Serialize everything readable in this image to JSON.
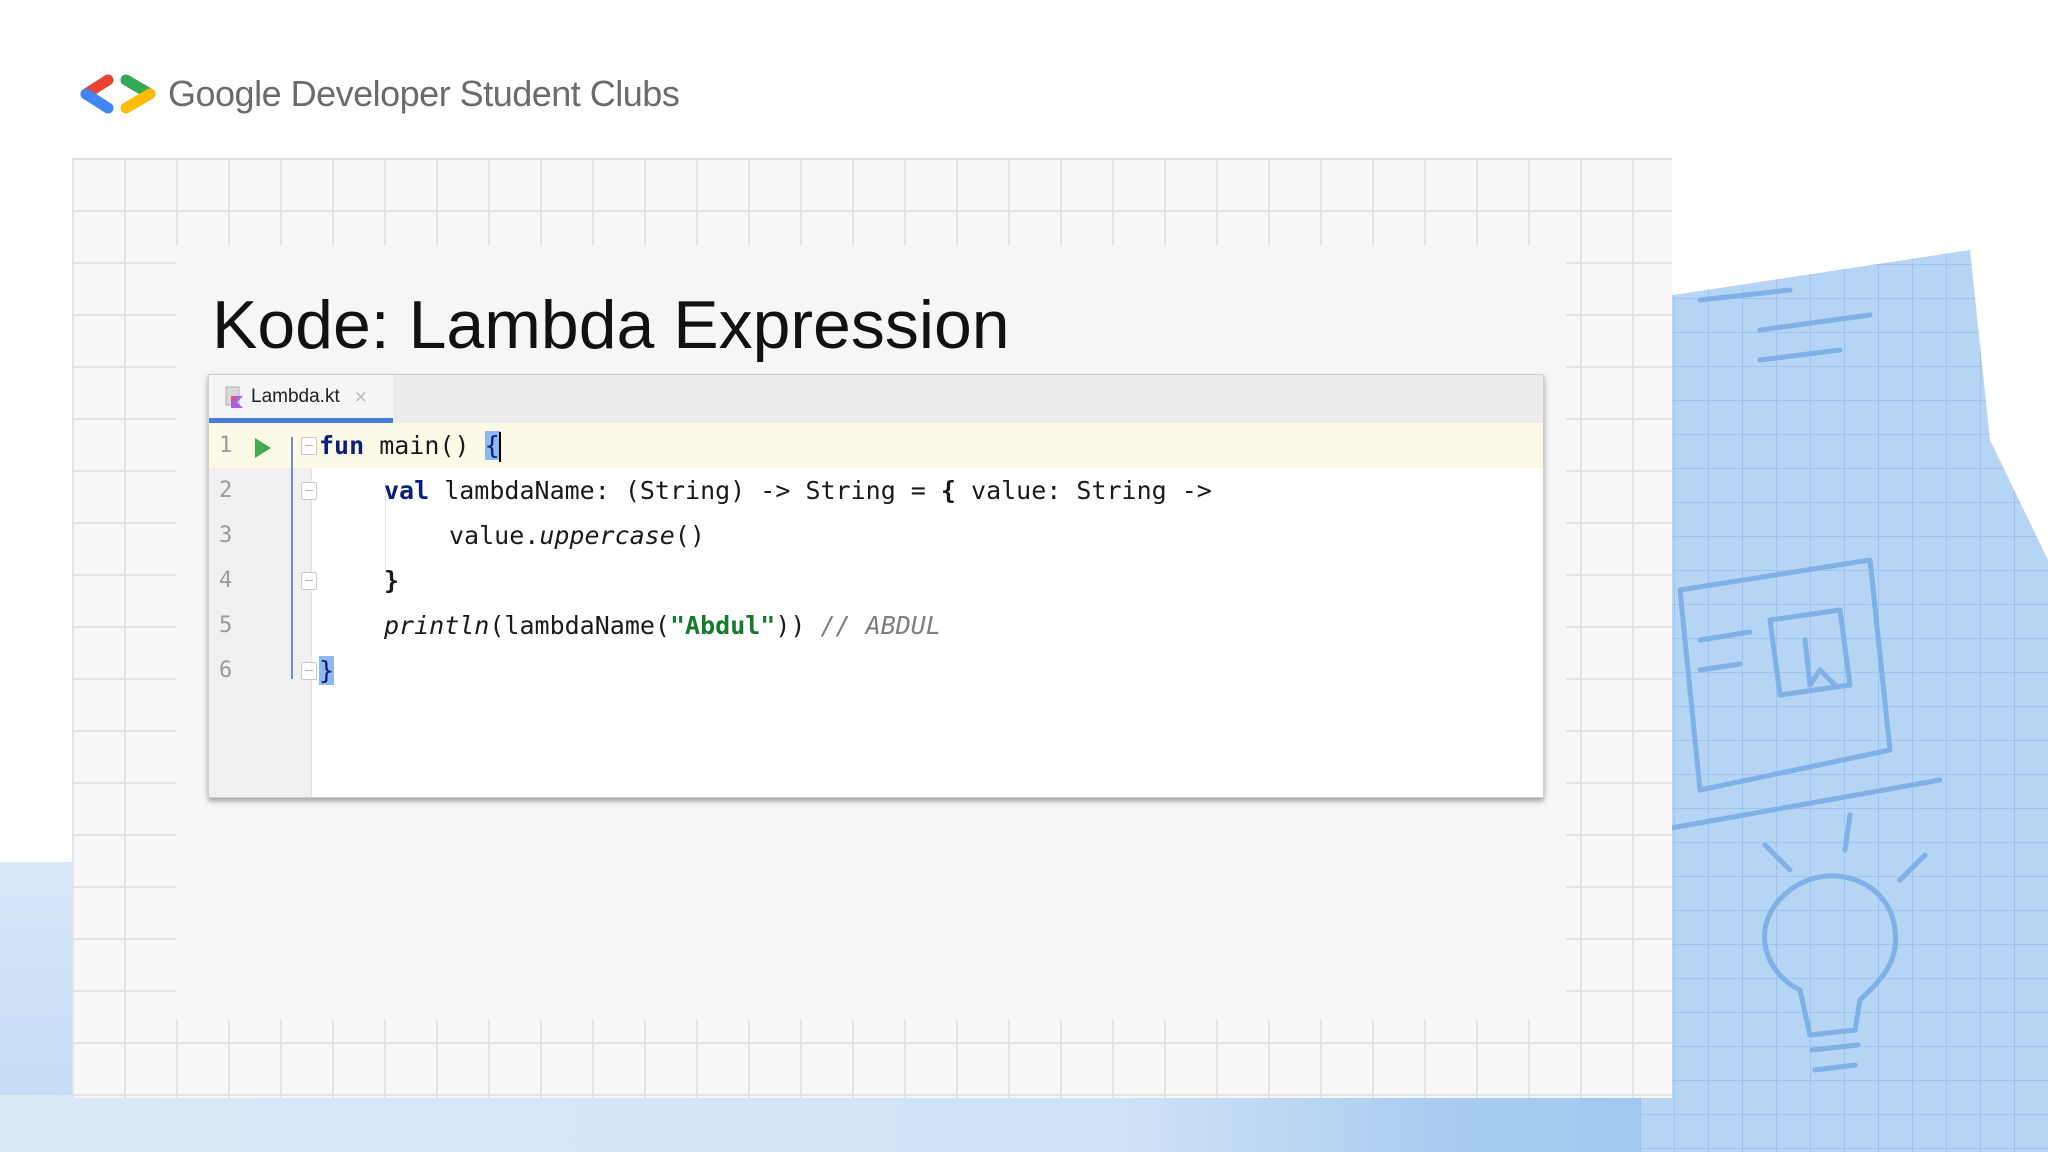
{
  "header": {
    "brand": "Google Developer Student Clubs",
    "logo_icon": "gdsc-brackets-icon",
    "logo_colors": {
      "red": "#ea4335",
      "blue": "#4285f4",
      "green": "#34a853",
      "yellow": "#fbbc04"
    }
  },
  "slide": {
    "title": "Kode: Lambda Expression"
  },
  "editor": {
    "tab": {
      "label": "Lambda.kt",
      "close_symbol": "×",
      "icon": "kotlin-file-icon"
    },
    "line_numbers": [
      "1",
      "2",
      "3",
      "4",
      "5",
      "6"
    ],
    "run_icon": "run-triangle-icon",
    "code": {
      "line1": {
        "kw": "fun",
        "rest": " main() ",
        "brace": "{"
      },
      "line2": {
        "kw": "val",
        "rest": " lambdaName: (String) -> String = ",
        "brace": "{",
        "tail": " value: String ->"
      },
      "line3": {
        "prefix": "value.",
        "fn": "uppercase",
        "suffix": "()"
      },
      "line4": {
        "brace": "}"
      },
      "line5": {
        "fn": "println",
        "mid": "(lambdaName(",
        "str": "\"Abdul\"",
        "close": "))",
        "comment": " // ABDUL"
      },
      "line6": {
        "brace": "}"
      }
    },
    "colors": {
      "keyword": "#0b1f7a",
      "string": "#137a2e",
      "comment": "#7e7e7e",
      "current_line": "#fcfae7",
      "brace_match": "#8fb8ef",
      "tab_underline": "#4a7ed6",
      "run_icon": "#3dae4f"
    }
  }
}
